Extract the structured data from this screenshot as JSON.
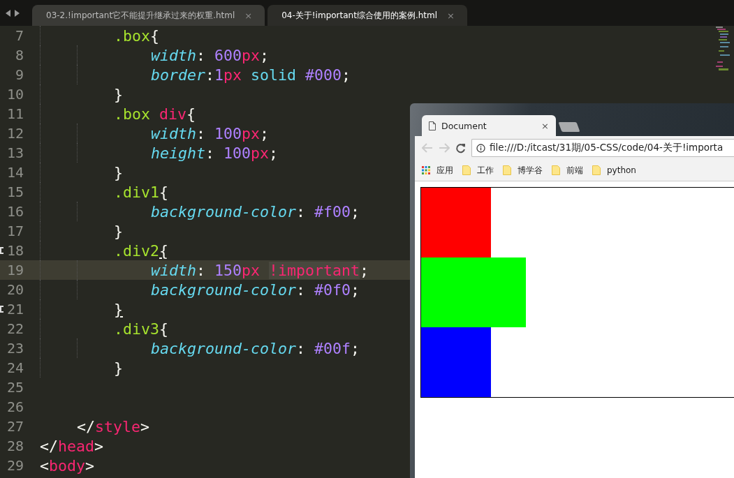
{
  "editor_tabs": [
    {
      "label": "03-2.!important它不能提升继承过来的权重.html",
      "close": "×",
      "selected": false
    },
    {
      "label": "04-关于!important综合使用的案例.html",
      "close": "×",
      "selected": true
    }
  ],
  "lines": [
    {
      "number": "7",
      "current": false,
      "marked": false,
      "kind": "rule",
      "tokens": [
        {
          "text": ".box",
          "kind": "selector"
        },
        {
          "text": "{",
          "kind": "punct"
        }
      ]
    },
    {
      "number": "8",
      "current": false,
      "marked": false,
      "kind": "declaration",
      "tokens": [
        {
          "text": "width",
          "kind": "property"
        },
        {
          "text": ": ",
          "kind": "punct"
        },
        {
          "text": "600",
          "kind": "number"
        },
        {
          "text": "px",
          "kind": "unit"
        },
        {
          "text": ";",
          "kind": "punct"
        }
      ]
    },
    {
      "number": "9",
      "current": false,
      "marked": false,
      "kind": "declaration",
      "tokens": [
        {
          "text": "border",
          "kind": "property"
        },
        {
          "text": ":",
          "kind": "punct"
        },
        {
          "text": "1",
          "kind": "number"
        },
        {
          "text": "px",
          "kind": "unit"
        },
        {
          "text": " solid",
          "kind": "keyword"
        },
        {
          "text": " #000",
          "kind": "number"
        },
        {
          "text": ";",
          "kind": "punct"
        }
      ]
    },
    {
      "number": "10",
      "current": false,
      "marked": false,
      "kind": "rule",
      "tokens": [
        {
          "text": "}",
          "kind": "punct"
        }
      ]
    },
    {
      "number": "11",
      "current": false,
      "marked": false,
      "kind": "rule",
      "tokens": [
        {
          "text": ".box",
          "kind": "selector"
        },
        {
          "text": " div",
          "kind": "unit"
        },
        {
          "text": "{",
          "kind": "punct"
        }
      ]
    },
    {
      "number": "12",
      "current": false,
      "marked": false,
      "kind": "declaration",
      "tokens": [
        {
          "text": "width",
          "kind": "property"
        },
        {
          "text": ": ",
          "kind": "punct"
        },
        {
          "text": "100",
          "kind": "number"
        },
        {
          "text": "px",
          "kind": "unit"
        },
        {
          "text": ";",
          "kind": "punct"
        }
      ]
    },
    {
      "number": "13",
      "current": false,
      "marked": false,
      "kind": "declaration",
      "tokens": [
        {
          "text": "height",
          "kind": "property"
        },
        {
          "text": ": ",
          "kind": "punct"
        },
        {
          "text": "100",
          "kind": "number"
        },
        {
          "text": "px",
          "kind": "unit"
        },
        {
          "text": ";",
          "kind": "punct"
        }
      ]
    },
    {
      "number": "14",
      "current": false,
      "marked": false,
      "kind": "rule",
      "tokens": [
        {
          "text": "}",
          "kind": "punct"
        }
      ]
    },
    {
      "number": "15",
      "current": false,
      "marked": false,
      "kind": "rule",
      "tokens": [
        {
          "text": ".div1",
          "kind": "selector"
        },
        {
          "text": "{",
          "kind": "punct"
        }
      ]
    },
    {
      "number": "16",
      "current": false,
      "marked": false,
      "kind": "declaration",
      "tokens": [
        {
          "text": "background-color",
          "kind": "property"
        },
        {
          "text": ": ",
          "kind": "punct"
        },
        {
          "text": "#f00",
          "kind": "number"
        },
        {
          "text": ";",
          "kind": "punct"
        }
      ]
    },
    {
      "number": "17",
      "current": false,
      "marked": false,
      "kind": "rule",
      "tokens": [
        {
          "text": "}",
          "kind": "punct"
        }
      ]
    },
    {
      "number": "18",
      "current": false,
      "marked": true,
      "kind": "rule",
      "tokens": [
        {
          "text": ".div2",
          "kind": "selector"
        },
        {
          "text": "{",
          "kind": "matched"
        }
      ]
    },
    {
      "number": "19",
      "current": true,
      "marked": false,
      "kind": "declaration",
      "tokens": [
        {
          "text": "width",
          "kind": "property"
        },
        {
          "text": ": ",
          "kind": "punct"
        },
        {
          "text": "150",
          "kind": "number"
        },
        {
          "text": "px ",
          "kind": "unit"
        },
        {
          "text": "!important",
          "kind": "important"
        },
        {
          "text": ";",
          "kind": "punct"
        }
      ]
    },
    {
      "number": "20",
      "current": false,
      "marked": false,
      "kind": "declaration",
      "tokens": [
        {
          "text": "background-color",
          "kind": "property"
        },
        {
          "text": ": ",
          "kind": "punct"
        },
        {
          "text": "#0f0",
          "kind": "number"
        },
        {
          "text": ";",
          "kind": "punct"
        }
      ]
    },
    {
      "number": "21",
      "current": false,
      "marked": true,
      "kind": "rule",
      "tokens": [
        {
          "text": "}",
          "kind": "matched"
        }
      ]
    },
    {
      "number": "22",
      "current": false,
      "marked": false,
      "kind": "rule",
      "tokens": [
        {
          "text": ".div3",
          "kind": "selector"
        },
        {
          "text": "{",
          "kind": "punct"
        }
      ]
    },
    {
      "number": "23",
      "current": false,
      "marked": false,
      "kind": "declaration",
      "tokens": [
        {
          "text": "background-color",
          "kind": "property"
        },
        {
          "text": ": ",
          "kind": "punct"
        },
        {
          "text": "#00f",
          "kind": "number"
        },
        {
          "text": ";",
          "kind": "punct"
        }
      ]
    },
    {
      "number": "24",
      "current": false,
      "marked": false,
      "kind": "rule",
      "tokens": [
        {
          "text": "}",
          "kind": "punct"
        }
      ]
    },
    {
      "number": "25",
      "current": false,
      "marked": false,
      "kind": "blank"
    },
    {
      "number": "26",
      "current": false,
      "marked": false,
      "kind": "blank"
    },
    {
      "number": "27",
      "current": false,
      "marked": false,
      "kind": "style-tag",
      "tokens": [
        {
          "text": "</",
          "kind": "punct"
        },
        {
          "text": "style",
          "kind": "unit"
        },
        {
          "text": ">",
          "kind": "punct"
        }
      ]
    },
    {
      "number": "28",
      "current": false,
      "marked": false,
      "kind": "head-tag",
      "tokens": [
        {
          "text": "</",
          "kind": "punct"
        },
        {
          "text": "head",
          "kind": "unit"
        },
        {
          "text": ">",
          "kind": "punct"
        }
      ]
    },
    {
      "number": "29",
      "current": false,
      "marked": false,
      "kind": "head-tag",
      "tokens": [
        {
          "text": "<",
          "kind": "punct"
        },
        {
          "text": "body",
          "kind": "unit"
        },
        {
          "text": ">",
          "kind": "punct"
        }
      ]
    }
  ],
  "browser": {
    "tab_title": "Document",
    "tab_close": "×",
    "url": "file:///D:/itcast/31期/05-CSS/code/04-关于!importa",
    "bookmarks": [
      {
        "label": "应用",
        "kind": "apps"
      },
      {
        "label": "工作",
        "kind": "folder"
      },
      {
        "label": "博学谷",
        "kind": "folder"
      },
      {
        "label": "前端",
        "kind": "folder"
      },
      {
        "label": "python",
        "kind": "folder"
      }
    ],
    "boxes": [
      {
        "color": "#ff0000",
        "kind": "narrow"
      },
      {
        "color": "#00ff00",
        "kind": "wide"
      },
      {
        "color": "#0000ff",
        "kind": "narrow"
      }
    ]
  }
}
